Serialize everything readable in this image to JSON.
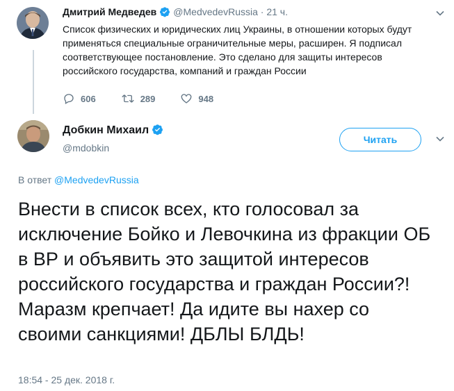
{
  "original_tweet": {
    "author_name": "Дмитрий Медведев",
    "handle": "@MedvedevRussia",
    "separator": "·",
    "time_ago": "21 ч.",
    "text": "Список физических и юридических лиц Украины, в отношении которых будут применяться специальные ограничительные меры, расширен. Я подписал соответствующее постановление. Это сделано для защиты интересов российского государства, компаний и граждан России",
    "replies": "606",
    "retweets": "289",
    "likes": "948"
  },
  "reply_tweet": {
    "author_name": "Добкин Михаил",
    "handle": "@mdobkin",
    "follow_label": "Читать",
    "in_reply_prefix": "В ответ",
    "in_reply_handle": "@MedvedevRussia",
    "text": "Внести в список всех, кто голосовал за исключение Бойко и Левочкина из фракции ОБ в ВР и объявить это защитой интересов российского государства и граждан России?! Маразм крепчает! Да идите вы нахер со своими санкциями! ДБЛЫ БЛДЬ!",
    "timestamp": "18:54 - 25 дек. 2018 г."
  },
  "colors": {
    "accent": "#1da1f2",
    "muted": "#657786",
    "text": "#14171a"
  }
}
